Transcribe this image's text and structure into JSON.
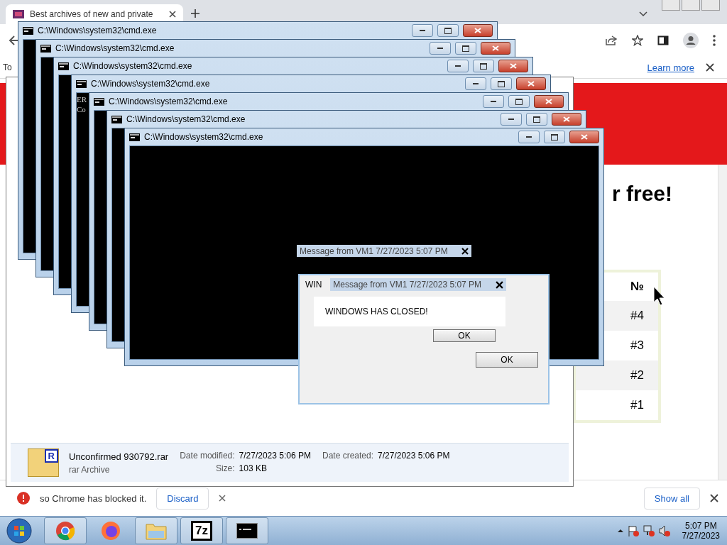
{
  "browser": {
    "tab": {
      "title": "Best archives of new and private"
    },
    "infobar": {
      "text": "To",
      "link": "Learn more"
    }
  },
  "page": {
    "heading": "r free!",
    "table": {
      "header": "№",
      "rows": [
        "#4",
        "#3",
        "#2",
        "#1"
      ]
    }
  },
  "explorer": {
    "file": {
      "name": "Unconfirmed 930792.rar",
      "type": "rar Archive",
      "badge": "R",
      "modified_label": "Date modified:",
      "modified": "7/27/2023 5:06 PM",
      "size_label": "Size:",
      "size": "103 KB",
      "created_label": "Date created:",
      "created": "7/27/2023 5:06 PM"
    }
  },
  "cmd_windows": [
    {
      "title": "C:\\Windows\\system32\\cmd.exe"
    },
    {
      "title": "C:\\Windows\\system32\\cmd.exe"
    },
    {
      "title": "C:\\Windows\\system32\\cmd.exe"
    },
    {
      "title": "C:\\Windows\\system32\\cmd.exe",
      "lines": [
        "ER",
        "Co"
      ]
    },
    {
      "title": "C:\\Windows\\system32\\cmd.exe"
    },
    {
      "title": "C:\\Windows\\system32\\cmd.exe"
    },
    {
      "title": "C:\\Windows\\system32\\cmd.exe"
    }
  ],
  "message_boxes": [
    {
      "title": "Message from VM1 7/27/2023 5:07 PM"
    },
    {
      "title": "Message from VM1 7/27/2023 5:07 PM",
      "side_text": "WIN",
      "body": "WINDOWS HAS CLOSED!",
      "buttons": [
        "OK",
        "OK"
      ]
    }
  ],
  "download_bar": {
    "text": "so Chrome has blocked it.",
    "discard": "Discard",
    "show_all": "Show all"
  },
  "taskbar": {
    "apps": [
      {
        "kind": "start"
      },
      {
        "kind": "chrome"
      },
      {
        "kind": "firefox"
      },
      {
        "kind": "folder"
      },
      {
        "kind": "archiver",
        "label": "7z"
      },
      {
        "kind": "console"
      }
    ],
    "clock": {
      "time": "5:07 PM",
      "date": "7/27/2023"
    }
  }
}
